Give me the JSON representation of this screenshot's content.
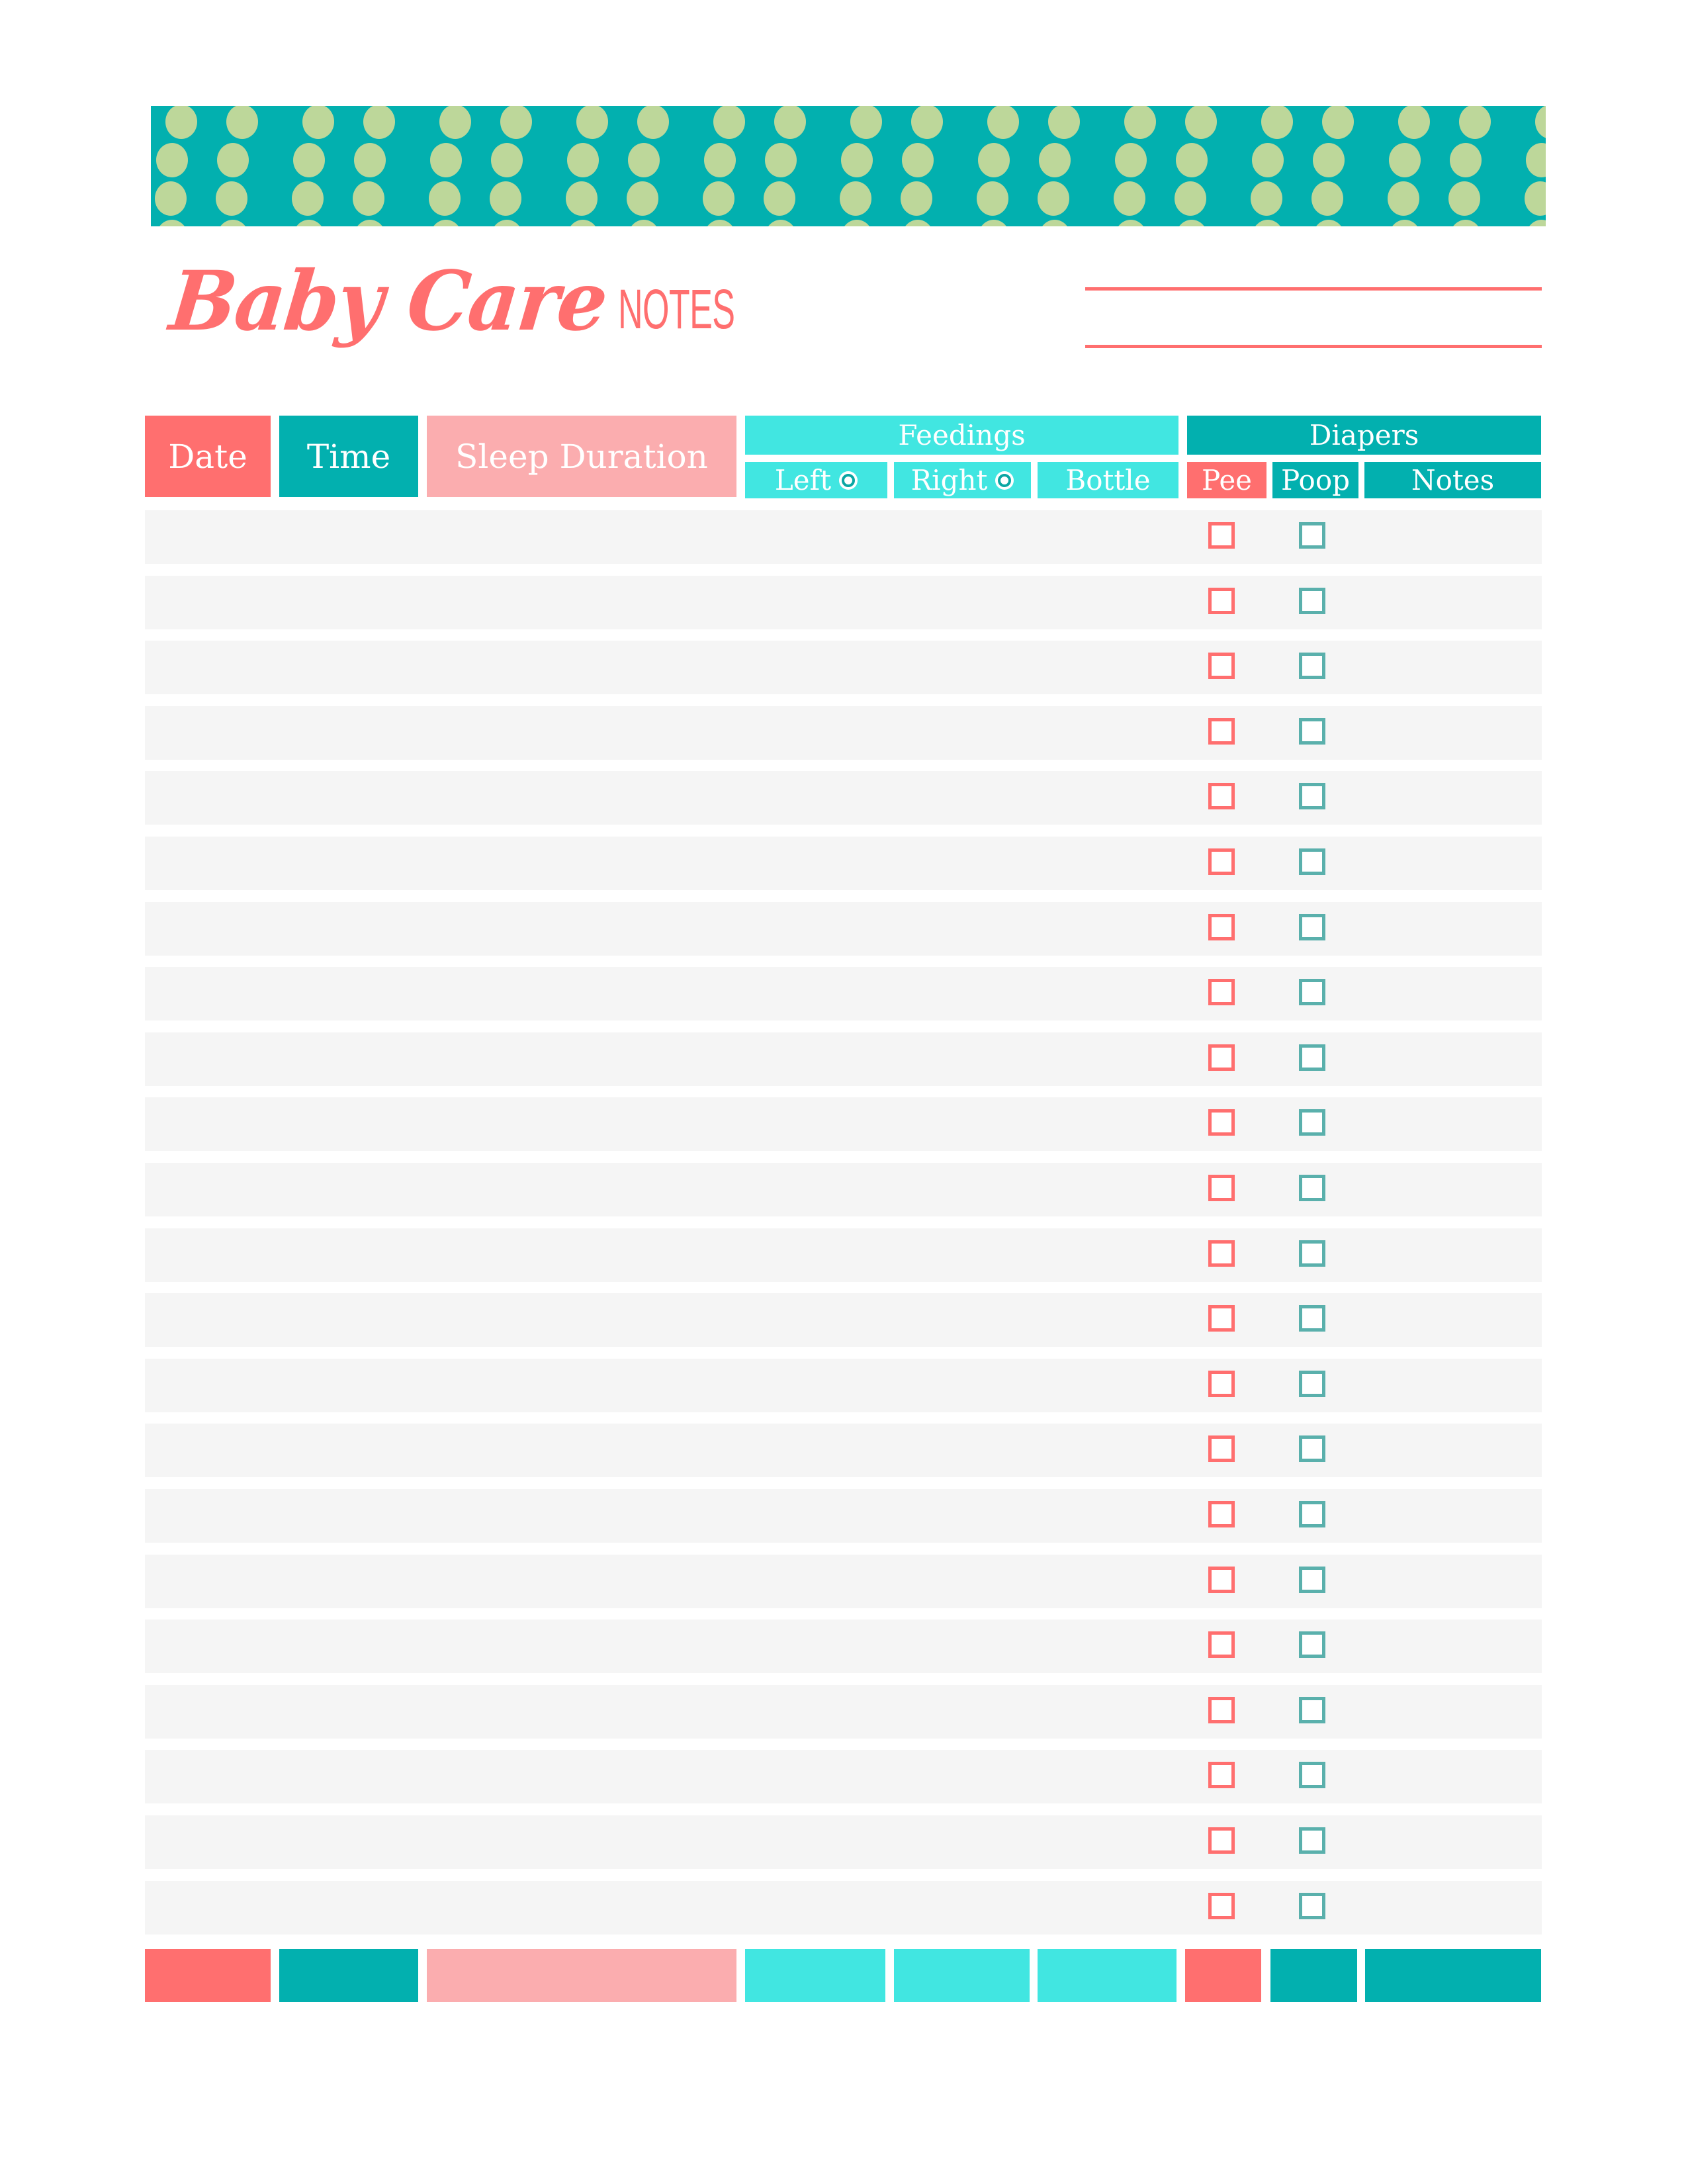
{
  "title": {
    "script": "Baby Care",
    "caps": "NOTES"
  },
  "header": {
    "date": "Date",
    "time": "Time",
    "sleep": "Sleep Duration",
    "feedings": {
      "label": "Feedings",
      "left": "Left",
      "right": "Right",
      "bottle": "Bottle",
      "side_icon": "breast-side-icon"
    },
    "diapers": {
      "label": "Diapers",
      "pee": "Pee",
      "poop": "Poop",
      "notes": "Notes"
    }
  },
  "rows": [
    {
      "pee": false,
      "poop": false
    },
    {
      "pee": false,
      "poop": false
    },
    {
      "pee": false,
      "poop": false
    },
    {
      "pee": false,
      "poop": false
    },
    {
      "pee": false,
      "poop": false
    },
    {
      "pee": false,
      "poop": false
    },
    {
      "pee": false,
      "poop": false
    },
    {
      "pee": false,
      "poop": false
    },
    {
      "pee": false,
      "poop": false
    },
    {
      "pee": false,
      "poop": false
    },
    {
      "pee": false,
      "poop": false
    },
    {
      "pee": false,
      "poop": false
    },
    {
      "pee": false,
      "poop": false
    },
    {
      "pee": false,
      "poop": false
    },
    {
      "pee": false,
      "poop": false
    },
    {
      "pee": false,
      "poop": false
    },
    {
      "pee": false,
      "poop": false
    },
    {
      "pee": false,
      "poop": false
    },
    {
      "pee": false,
      "poop": false
    },
    {
      "pee": false,
      "poop": false
    },
    {
      "pee": false,
      "poop": false
    },
    {
      "pee": false,
      "poop": false
    }
  ],
  "colors": {
    "coral": "#FF6F6F",
    "teal": "#02B0AF",
    "pink": "#FBADAF",
    "aqua": "#41E6E1",
    "dot": "#BDD79A",
    "row_bg": "#F5F5F5",
    "poop_checkbox": "#5AB0AC"
  }
}
